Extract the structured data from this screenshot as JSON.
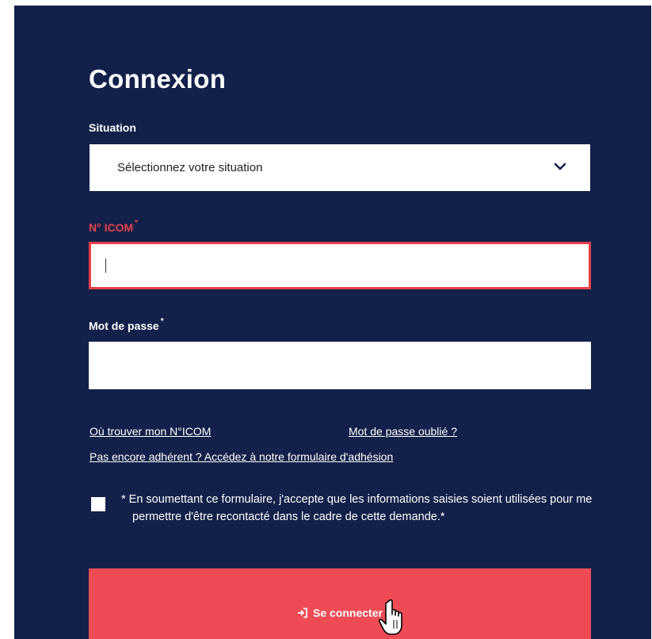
{
  "form": {
    "title": "Connexion",
    "situation": {
      "label": "Situation",
      "selected": "Sélectionnez votre situation"
    },
    "icom": {
      "label": "N° ICOM",
      "required_mark": "*",
      "value": ""
    },
    "password": {
      "label": "Mot de passe",
      "required_mark": "*",
      "value": ""
    },
    "links": {
      "find_icom": "Où trouver mon N°ICOM",
      "forgot_password": "Mot de passe oublié ?",
      "register": "Pas encore adhérent ? Accédez à notre formulaire d'adhésion"
    },
    "consent": {
      "checked": false,
      "text": "* En soumettant ce formulaire, j'accepte que les informations saisies soient utilisées pour me permettre d'être recontacté dans le cadre de cette demande.*"
    },
    "submit": {
      "label": "Se connecter",
      "icon": "login-icon"
    }
  },
  "colors": {
    "panel_bg": "#13214a",
    "accent_red": "#e6414b",
    "button_red": "#ef4b55",
    "text_white": "#ffffff"
  },
  "icons": {
    "select_chevron": "chevron-down-icon",
    "pointer": "hand-cursor-icon"
  }
}
